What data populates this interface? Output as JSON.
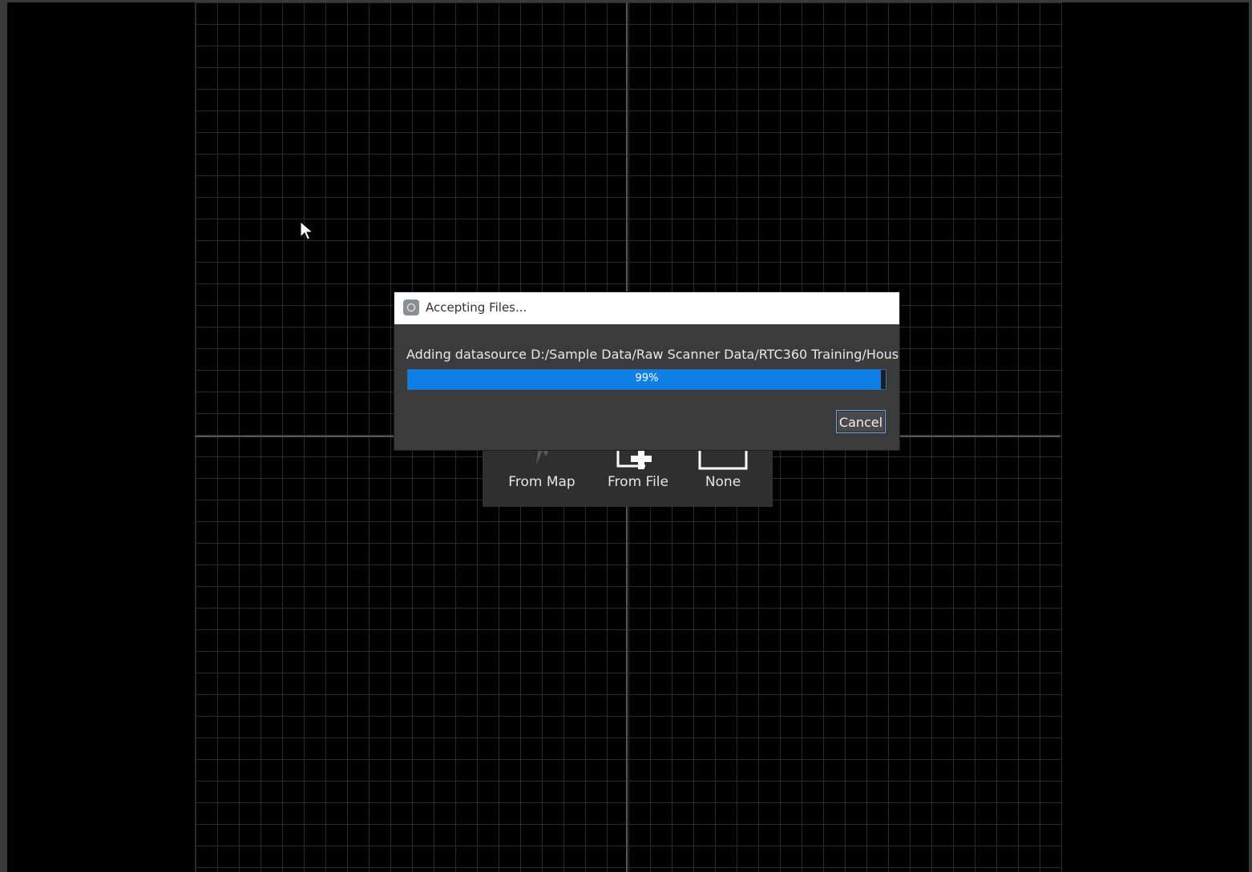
{
  "dialog": {
    "title": "Accepting Files...",
    "message": "Adding datasource D:/Sample Data/Raw Scanner Data/RTC360 Training/Hous",
    "progress_value": 0.99,
    "progress_label": "99%",
    "cancel_label": "Cancel",
    "icon": "app-gear-icon"
  },
  "chooser": {
    "options": [
      {
        "label": "From Map",
        "icon": "map-icon"
      },
      {
        "label": "From File",
        "icon": "add-file-icon"
      },
      {
        "label": "None",
        "icon": "empty-box-icon"
      }
    ]
  },
  "colors": {
    "background": "#000000",
    "grid": "#2b2b2b",
    "axis": "#555555",
    "dialog_bg": "#3b3b3b",
    "progress_fill": "#0f7fe6",
    "button_border": "#6fa7e6"
  }
}
